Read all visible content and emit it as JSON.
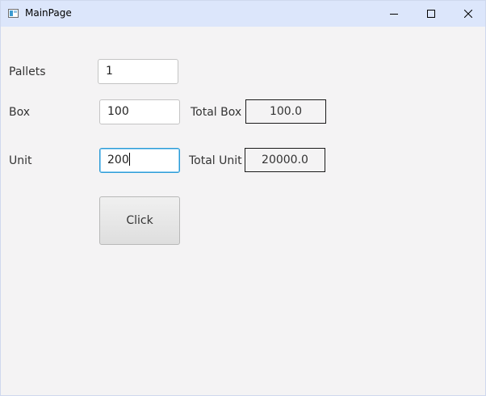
{
  "window": {
    "title": "MainPage",
    "icons": [
      "app-icon",
      "minimize-icon",
      "maximize-icon",
      "close-icon"
    ]
  },
  "form": {
    "pallets_label": "Pallets",
    "pallets_value": "1",
    "box_label": "Box",
    "box_value": "100",
    "total_box_label": "Total Box",
    "total_box_value": "100.0",
    "unit_label": "Unit",
    "unit_value": "200",
    "total_unit_label": "Total Unit",
    "total_unit_value": "20000.0",
    "click_label": "Click"
  },
  "colors": {
    "titlebar": "#dce6fb",
    "background": "#f4f3f4",
    "focus_border": "#2a9bd6"
  }
}
